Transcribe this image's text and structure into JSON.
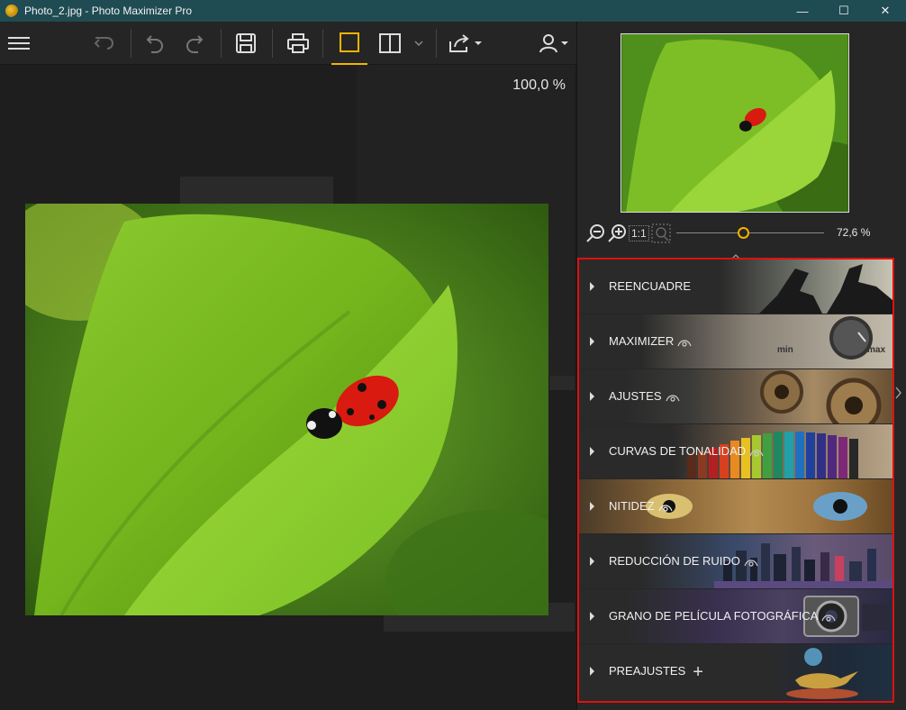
{
  "window": {
    "title": "Photo_2.jpg - Photo Maximizer Pro"
  },
  "window_buttons": {
    "minimize": "—",
    "maximize": "☐",
    "close": "✕"
  },
  "canvas": {
    "zoom_label": "100,0 %"
  },
  "navigator": {
    "zoom_value": "72,6 %",
    "one_to_one": "1:1",
    "zoom_slider_fraction": 0.45
  },
  "accordion": {
    "items": [
      {
        "label": "REENCUADRE",
        "eye": false
      },
      {
        "label": "MAXIMIZER",
        "eye": true,
        "min_label": "min",
        "max_label": "max"
      },
      {
        "label": "AJUSTES",
        "eye": true
      },
      {
        "label": "CURVAS DE TONALIDAD",
        "eye": true
      },
      {
        "label": "NITIDEZ",
        "eye": true
      },
      {
        "label": "REDUCCIÓN DE RUIDO",
        "eye": true
      },
      {
        "label": "GRANO DE PELÍCULA FOTOGRÁFICA",
        "eye": true
      },
      {
        "label": "PREAJUSTES",
        "eye": false,
        "plus": "+"
      }
    ]
  },
  "colors": {
    "titlebar": "#1f4b53",
    "accent": "#f0b400",
    "highlight_border": "#e01010"
  }
}
